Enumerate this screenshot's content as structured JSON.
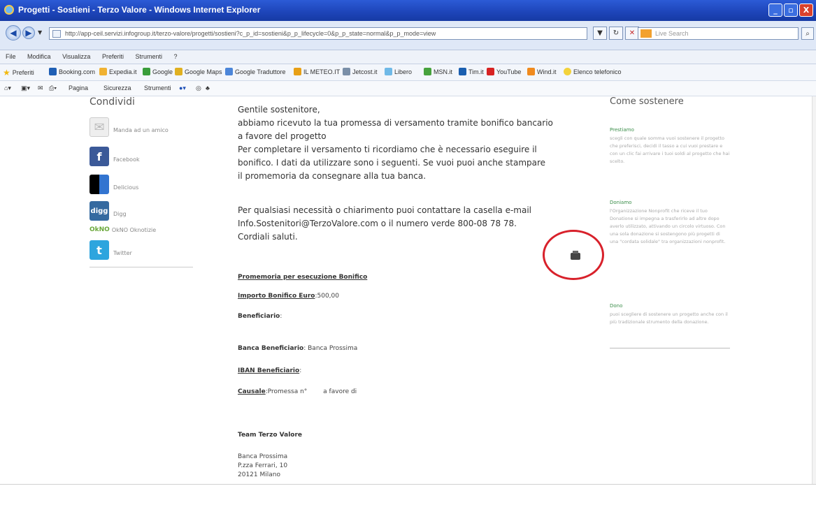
{
  "window": {
    "title": "Progetti - Sostieni - Terzo Valore - Windows Internet Explorer",
    "minimize": "_",
    "maximize": "▫",
    "close": "X"
  },
  "address": {
    "url": "http://app-ceil.servizi.infogroup.it/terzo-valore/progetti/sostieni?c_p_id=sostieni&p_p_lifecycle=0&p_p_state=normal&p_p_mode=view",
    "search_placeholder": "Live Search"
  },
  "menu": [
    "File",
    "Modifica",
    "Visualizza",
    "Preferiti",
    "Strumenti",
    "?"
  ],
  "favorites": {
    "label": "Preferiti",
    "items": [
      {
        "label": "Booking.com",
        "color": "#1f5fb5"
      },
      {
        "label": "Expedia.it",
        "color": "#f0b232"
      },
      {
        "label": "Google",
        "color": "#3a9d3a"
      },
      {
        "label": "Google Maps",
        "color": "#e0b020"
      },
      {
        "label": "Google Traduttore",
        "color": "#4c86d9"
      },
      {
        "label": "IL METEO.IT",
        "color": "#e8a016"
      },
      {
        "label": "Jetcost.it",
        "color": "#7a8fa8"
      },
      {
        "label": "Libero",
        "color": "#6fb9e7"
      },
      {
        "label": "MSN.it",
        "color": "#47a23d"
      },
      {
        "label": "Tim.it",
        "color": "#1b5fb0"
      },
      {
        "label": "YouTube",
        "color": "#d72222"
      },
      {
        "label": "Wind.it",
        "color": "#f08a1e"
      },
      {
        "label": "Elenco telefonico",
        "color": "#f3d23a"
      }
    ]
  },
  "commands": [
    "Pagina",
    "Sicurezza",
    "Strumenti"
  ],
  "left": {
    "title": "Condividi",
    "items": [
      {
        "label": "Manda ad un amico",
        "icon": "mail-icon"
      },
      {
        "label": "Facebook",
        "icon": "facebook-icon"
      },
      {
        "label": "Delicious",
        "icon": "delicious-icon"
      },
      {
        "label": "Digg",
        "icon": "digg-icon"
      },
      {
        "label": "OkNO Oknotizie",
        "icon": "oknotizie-icon"
      },
      {
        "label": "Twitter",
        "icon": "twitter-icon"
      }
    ]
  },
  "message": {
    "p1_l1": "Gentile sostenitore,",
    "p1_l2": "abbiamo ricevuto la tua promessa di versamento tramite bonifico bancario",
    "p1_l3": "a favore del progetto",
    "p1_l4": "Per completare il versamento ti ricordiamo che è necessario eseguire il",
    "p1_l5": "bonifico. I dati da utilizzare sono i seguenti. Se vuoi puoi anche stampare",
    "p1_l6": "il promemoria da consegnare alla tua banca.",
    "p2_l1": "Per qualsiasi necessità o chiarimento puoi contattare la casella e-mail",
    "p2_l2": "Info.Sostenitori@TerzoValore.com o il numero verde 800-08 78 78.",
    "p2_l3": "Cordiali saluti."
  },
  "promemoria": {
    "title": "Promemoria per esecuzione Bonifico",
    "importo_label": "Importo Bonifico Euro",
    "importo_value": ":500,00",
    "beneficiario_label": "Beneficiario",
    "beneficiario_value": ":",
    "banca_label": "Banca Beneficiario",
    "banca_value": ": Banca Prossima",
    "iban_label": "IBAN Beneficiario",
    "iban_value": ":",
    "causale_label": "Causale",
    "causale_value": ":Promessa n°        a favore di",
    "team": "Team Terzo Valore",
    "addr1": "Banca Prossima",
    "addr2": "P.zza Ferrari, 10",
    "addr3": "20121 Milano"
  },
  "right": {
    "title": "Come sostenere",
    "sections": [
      {
        "title": "Prestiamo",
        "text": "scegli con quale somma vuoi sostenere il progetto che preferisci, decidi il tasso a cui vuoi prestare e con un clic fai arrivare i tuoi soldi al progetto che hai scelto."
      },
      {
        "title": "Doniamo",
        "text": "l'Organizzazione Nonprofit che riceve il tuo Donatione si impegna a trasferirlo ad altre dopo averlo utilizzato, attivando un circolo virtuoso. Con una sola donazione si sostengono più progetti di una \"cordata solidale\" tra organizzazioni nonprofit."
      },
      {
        "title": "Dono",
        "text": "puoi scegliere di sostenere un progetto anche con il più tradizionale strumento della donazione."
      }
    ]
  }
}
